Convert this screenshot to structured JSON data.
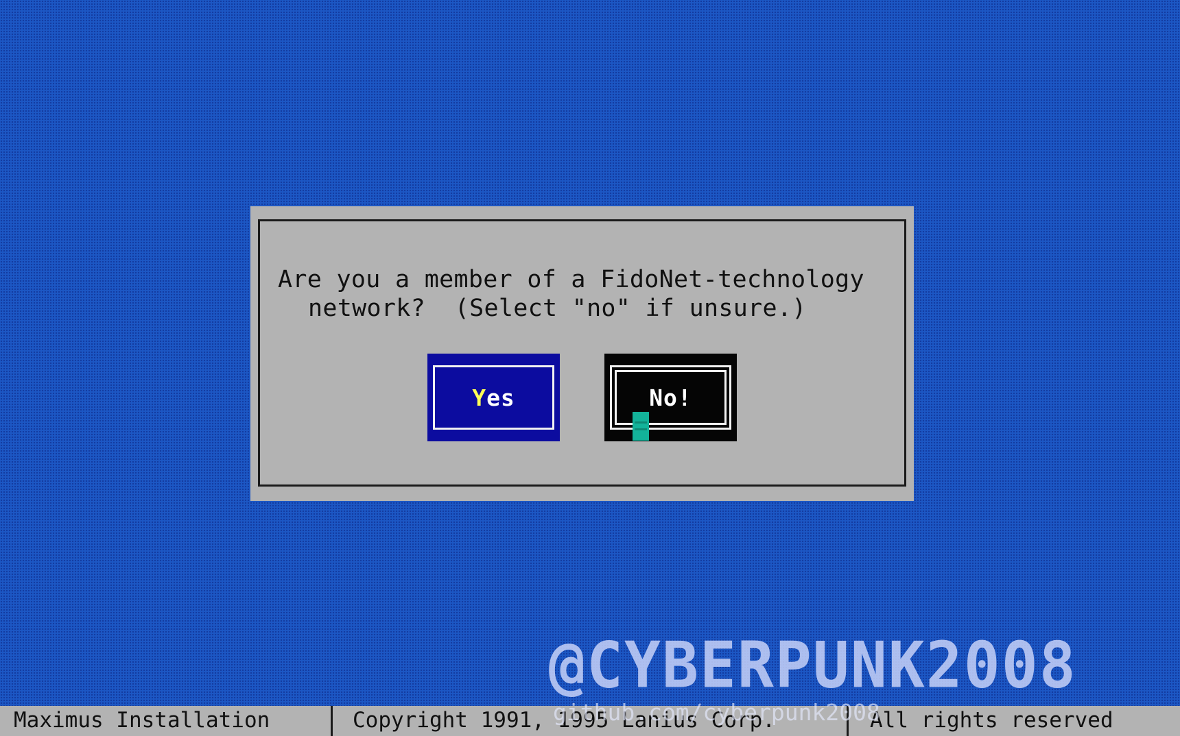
{
  "dialog": {
    "message_line1": "Are you a member of a FidoNet-technology",
    "message_line2": "network?  (Select \"no\" if unsure.)",
    "yes_button": {
      "hotkey": "Y",
      "rest": "es"
    },
    "no_button": {
      "label": "No!"
    }
  },
  "status_bar": {
    "app_name": "Maximus Installation",
    "copyright": "Copyright 1991, 1995 Lanius Corp.",
    "rights": "All rights reserved"
  },
  "watermark": {
    "main": "@CYBERPUNK2008",
    "url": "github.com/cyberpunk2008"
  },
  "colors": {
    "desktop_background": "#1c57c4",
    "dialog_background": "#b3b3b3",
    "yes_button": "#0c0c9f",
    "no_button_selected": "#050505",
    "hotkey": "#ffff55",
    "mouse_cursor": "#13b39a"
  }
}
